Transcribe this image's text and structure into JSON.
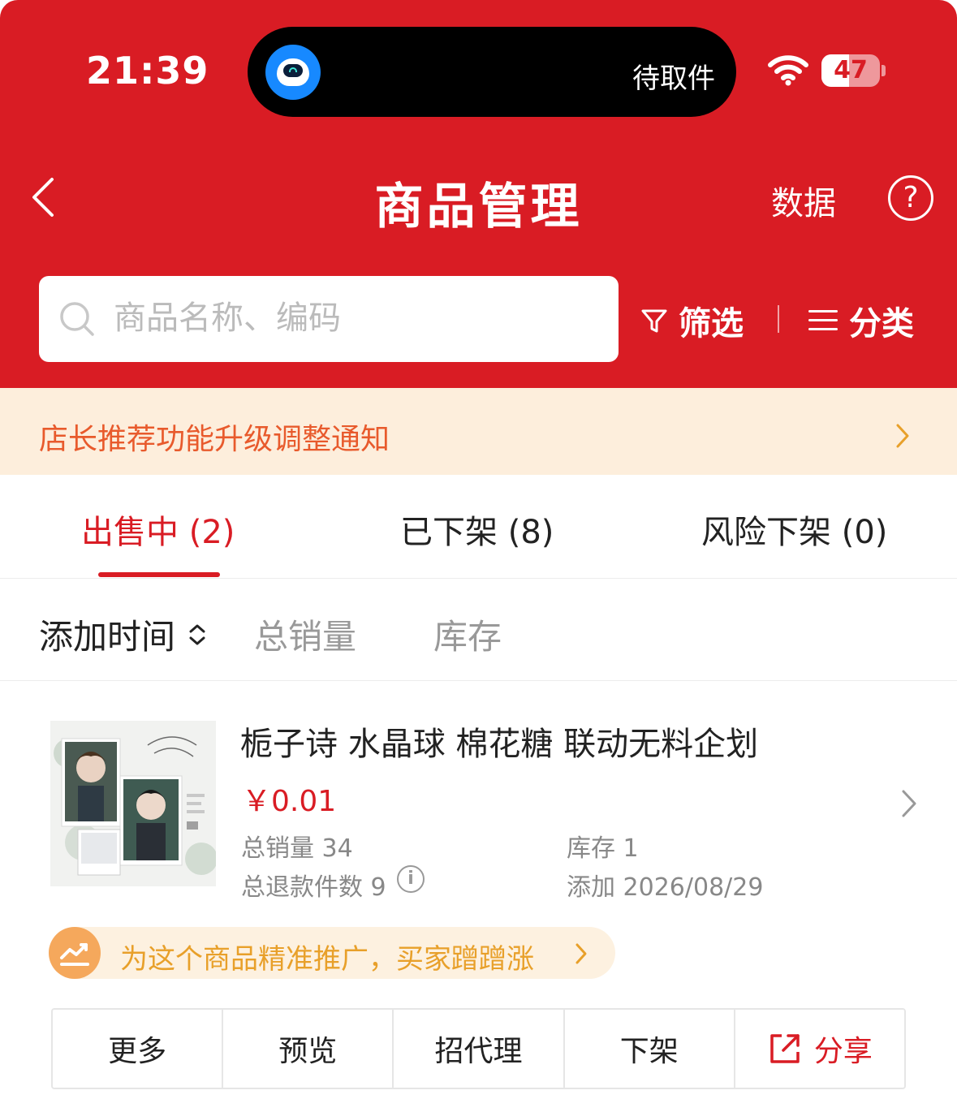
{
  "status_bar": {
    "time": "21:39",
    "island_text": "待取件",
    "battery": "47",
    "battery_level": 0.47
  },
  "nav": {
    "title": "商品管理",
    "data_label": "数据",
    "help_symbol": "?"
  },
  "search": {
    "placeholder": "商品名称、编码",
    "value": ""
  },
  "toolbar": {
    "filter_label": "筛选",
    "category_label": "分类"
  },
  "notice": {
    "text": "店长推荐功能升级调整通知"
  },
  "tabs": [
    {
      "label": "出售中 (2)",
      "active": true
    },
    {
      "label": "已下架 (8)",
      "active": false
    },
    {
      "label": "风险下架 (0)",
      "active": false
    }
  ],
  "sort": {
    "items": [
      "添加时间",
      "总销量",
      "库存"
    ]
  },
  "product": {
    "title": "栀子诗 水晶球 棉花糖 联动无料企划",
    "price": "￥0.01",
    "sales": "总销量 34",
    "stock": "库存 1",
    "refunds": "总退款件数 9",
    "added": "添加 2026/08/29",
    "info_symbol": "i"
  },
  "promo": {
    "text": "为这个商品精准推广，买家蹭蹭涨"
  },
  "actions": [
    "更多",
    "预览",
    "招代理",
    "下架",
    "分享"
  ],
  "colors": {
    "brand_red": "#d91c24",
    "notice_bg": "#fdeedc",
    "notice_text": "#e85a2c",
    "promo_text": "#e8a02a"
  }
}
